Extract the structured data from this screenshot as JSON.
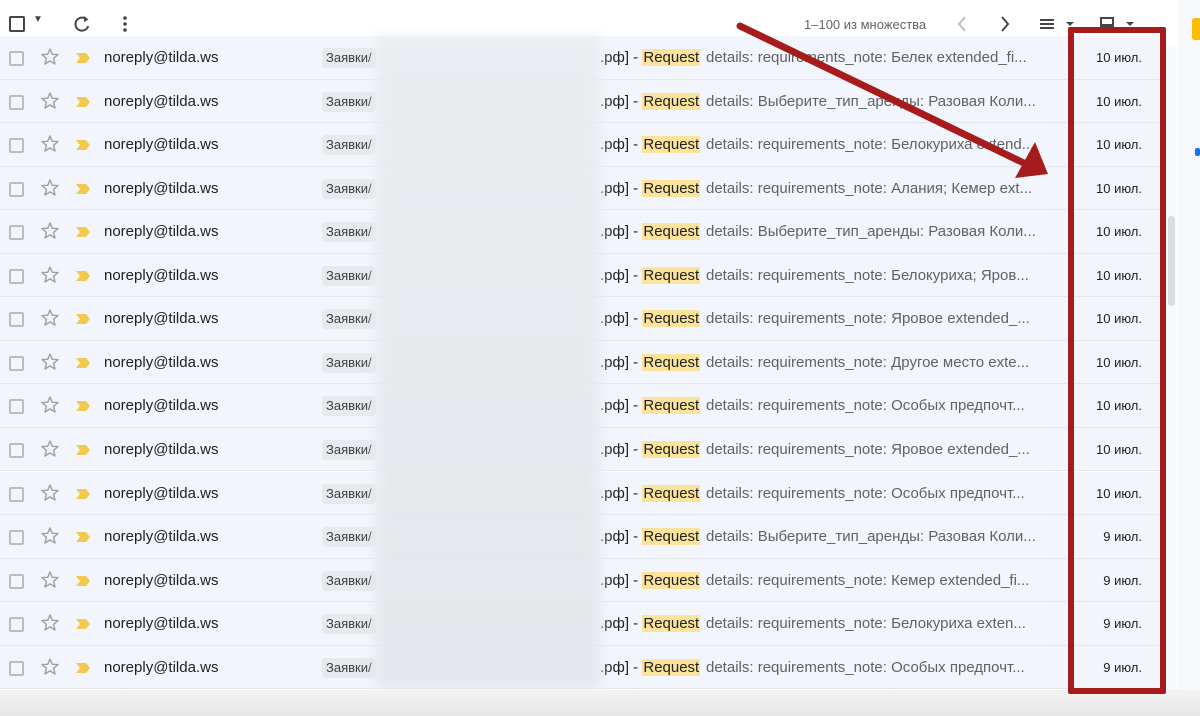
{
  "toolbar": {
    "pagination": "1–100 из множества"
  },
  "colors": {
    "row_bg": "#f2f6fc",
    "highlight": "#fbe39b",
    "important_marker": "#f2c94c",
    "annotation": "#a61b1b"
  },
  "icons": [
    "checkbox-icon",
    "chevron-down-icon",
    "refresh-icon",
    "more-vert-icon",
    "chevron-left-icon",
    "chevron-right-icon",
    "density-icon",
    "split-pane-icon",
    "star-icon",
    "important-marker-icon"
  ],
  "rows": [
    {
      "sender": "noreply@tilda.ws",
      "label": "Заявки/",
      "subject_tail": ".рф] - ",
      "keyword": "Request",
      "snippet": " details: requirements_note: Белек extended_fi...",
      "date": "10 июл."
    },
    {
      "sender": "noreply@tilda.ws",
      "label": "Заявки/",
      "subject_tail": ".рф] - ",
      "keyword": "Request",
      "snippet": " details: Выберите_тип_аренды: Разовая Коли...",
      "date": "10 июл."
    },
    {
      "sender": "noreply@tilda.ws",
      "label": "Заявки/",
      "subject_tail": ".рф] - ",
      "keyword": "Request",
      "snippet": " details: requirements_note: Белокуриха extend...",
      "date": "10 июл."
    },
    {
      "sender": "noreply@tilda.ws",
      "label": "Заявки/",
      "subject_tail": ".рф] - ",
      "keyword": "Request",
      "snippet": " details: requirements_note: Алания; Кемер ext...",
      "date": "10 июл."
    },
    {
      "sender": "noreply@tilda.ws",
      "label": "Заявки/",
      "subject_tail": ".рф] - ",
      "keyword": "Request",
      "snippet": " details: Выберите_тип_аренды: Разовая Коли...",
      "date": "10 июл."
    },
    {
      "sender": "noreply@tilda.ws",
      "label": "Заявки/",
      "subject_tail": ".рф] - ",
      "keyword": "Request",
      "snippet": " details: requirements_note: Белокуриха; Яров...",
      "date": "10 июл."
    },
    {
      "sender": "noreply@tilda.ws",
      "label": "Заявки/",
      "subject_tail": ".рф] - ",
      "keyword": "Request",
      "snippet": " details: requirements_note: Яровое extended_...",
      "date": "10 июл."
    },
    {
      "sender": "noreply@tilda.ws",
      "label": "Заявки/",
      "subject_tail": ".рф] - ",
      "keyword": "Request",
      "snippet": " details: requirements_note: Другое место exte...",
      "date": "10 июл."
    },
    {
      "sender": "noreply@tilda.ws",
      "label": "Заявки/",
      "subject_tail": ".рф] - ",
      "keyword": "Request",
      "snippet": " details: requirements_note: Особых предпочт...",
      "date": "10 июл."
    },
    {
      "sender": "noreply@tilda.ws",
      "label": "Заявки/",
      "subject_tail": ".рф] - ",
      "keyword": "Request",
      "snippet": " details: requirements_note: Яровое extended_...",
      "date": "10 июл."
    },
    {
      "sender": "noreply@tilda.ws",
      "label": "Заявки/",
      "subject_tail": ".рф] - ",
      "keyword": "Request",
      "snippet": " details: requirements_note: Особых предпочт...",
      "date": "10 июл."
    },
    {
      "sender": "noreply@tilda.ws",
      "label": "Заявки/",
      "subject_tail": ".рф] - ",
      "keyword": "Request",
      "snippet": " details: Выберите_тип_аренды: Разовая Коли...",
      "date": "9 июл."
    },
    {
      "sender": "noreply@tilda.ws",
      "label": "Заявки/",
      "subject_tail": ".рф] - ",
      "keyword": "Request",
      "snippet": " details: requirements_note: Кемер extended_fi...",
      "date": "9 июл."
    },
    {
      "sender": "noreply@tilda.ws",
      "label": "Заявки/",
      "subject_tail": ".рф] - ",
      "keyword": "Request",
      "snippet": " details: requirements_note: Белокуриха exten...",
      "date": "9 июл."
    },
    {
      "sender": "noreply@tilda.ws",
      "label": "Заявки/",
      "subject_tail": ".рф] - ",
      "keyword": "Request",
      "snippet": " details: requirements_note: Особых предпочт...",
      "date": "9 июл."
    }
  ]
}
